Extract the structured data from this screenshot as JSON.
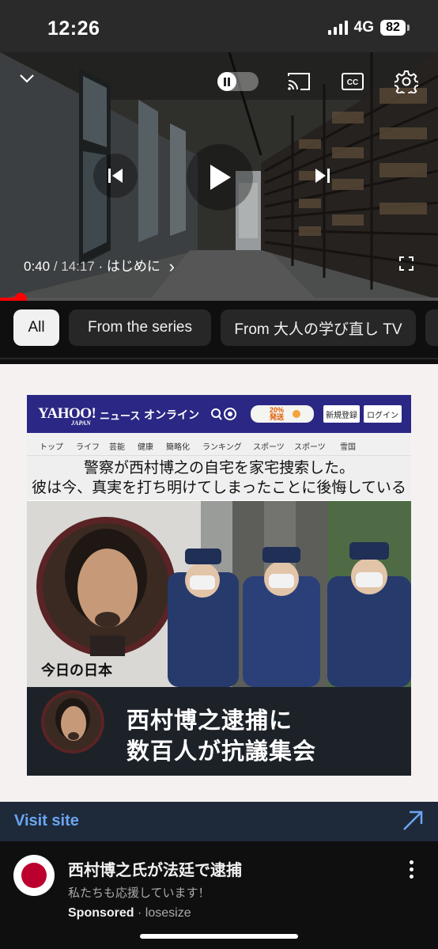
{
  "status_bar": {
    "time": "12:26",
    "network": "4G",
    "battery": "82"
  },
  "player": {
    "current_time": "0:40",
    "separator": " / ",
    "duration": "14:17",
    "chapter_sep": " · ",
    "chapter": "はじめに",
    "chapter_arrow": "›",
    "progress_fraction": 0.047
  },
  "chips": [
    "All",
    "From the series",
    "From 大人の学び直し TV",
    ""
  ],
  "ad": {
    "image": {
      "logo": "YAHOO!",
      "logo_sub": "JAPAN",
      "news": "ニュース",
      "online": "オンライン",
      "promo": "20%\n発送",
      "btn_register": "新規登録",
      "btn_login": "ログイン",
      "nav": [
        "トップ",
        "ライフ",
        "芸能",
        "健康",
        "簡略化",
        "ランキング",
        "スポーツ",
        "スポーツ",
        "雪国"
      ],
      "headline_1": "警察が西村博之の自宅を家宅捜索した。",
      "headline_2": "彼は今、真実を打ち明けてしまったことに後悔している",
      "today_label": "今日の日本",
      "big_1": "西村博之逮捕に",
      "big_2": "数百人が抗議集会"
    },
    "visit_label": "Visit site",
    "title": "西村博之氏が法廷で逮捕",
    "subtitle": "私たちも応援しています！",
    "sponsored": "Sponsored",
    "dot": " · ",
    "source": "losesize"
  },
  "colors": {
    "accent_red": "#ff0000",
    "link_blue": "#6aa6f2",
    "yahoo_purple": "#2b2784"
  }
}
